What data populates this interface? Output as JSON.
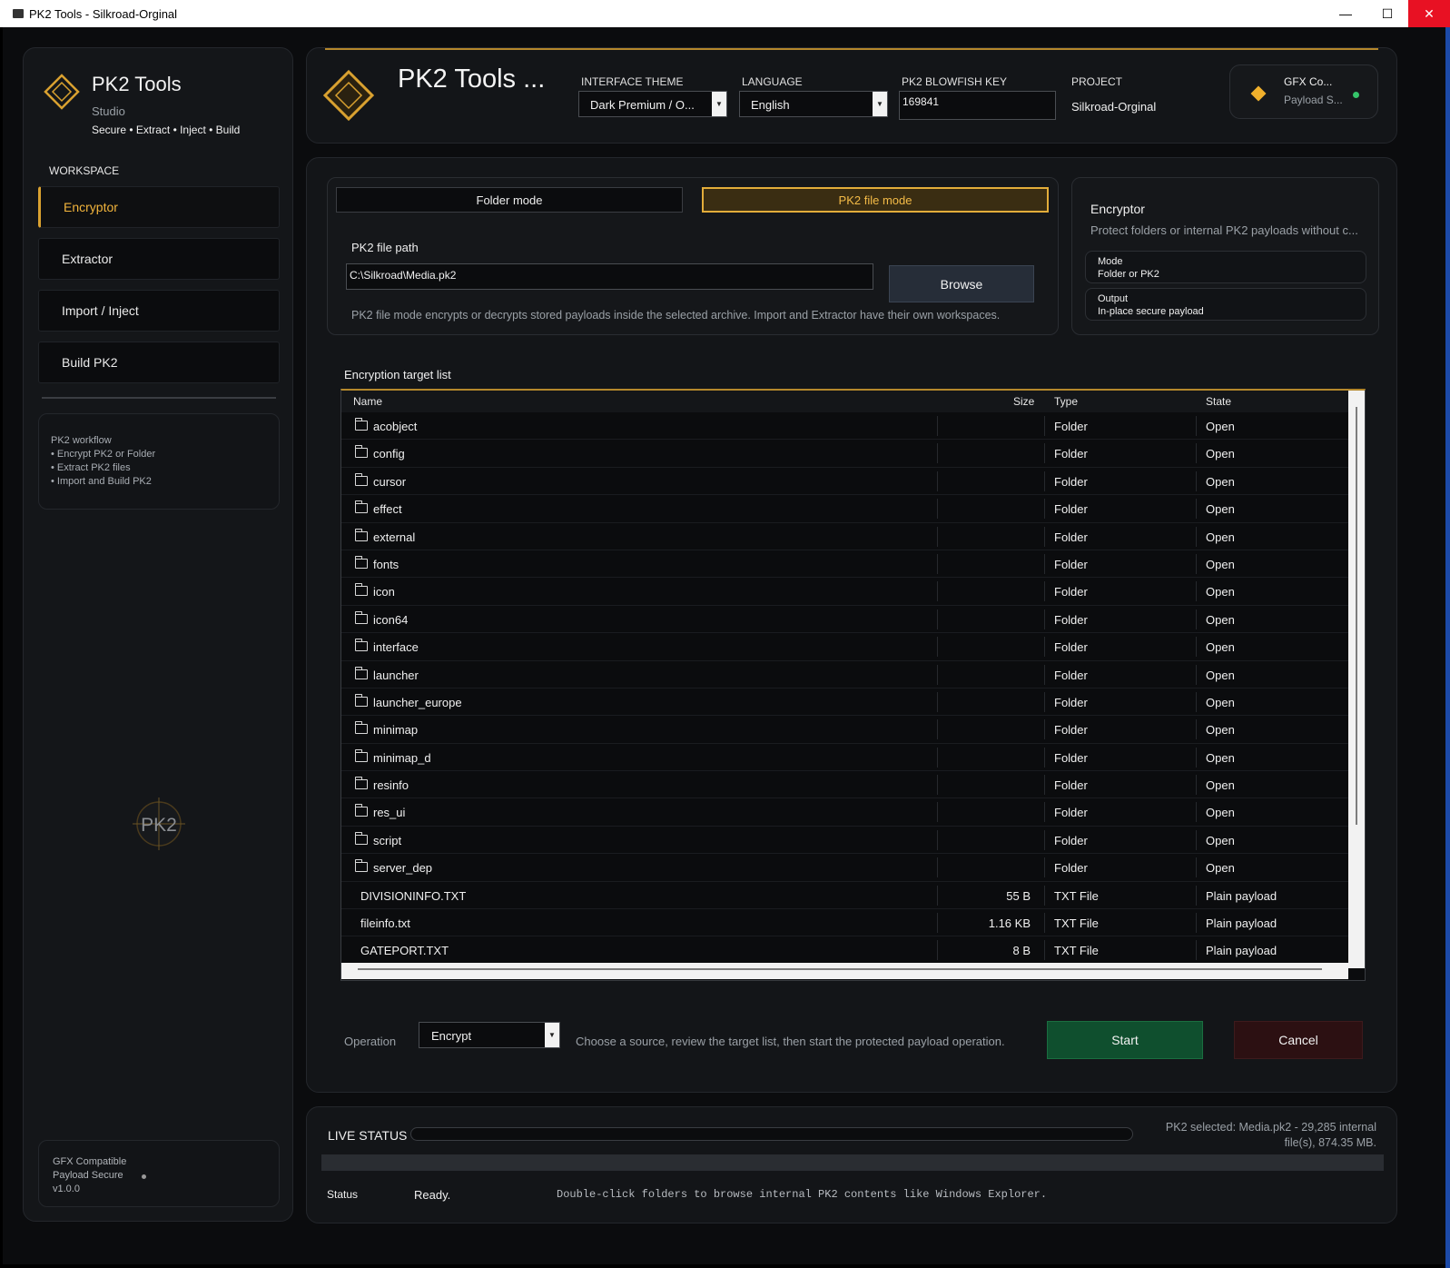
{
  "window": {
    "title": "PK2 Tools - Silkroad-Orginal",
    "controls": {
      "minimize": "—",
      "maximize": "☐",
      "close": "✕"
    }
  },
  "sidebar": {
    "brand_title": "PK2 Tools",
    "brand_subtitle": "Studio",
    "brand_tagline": "Secure • Extract • Inject • Build",
    "workspace_label": "WORKSPACE",
    "nav": [
      "Encryptor",
      "Extractor",
      "Import / Inject",
      "Build PK2"
    ],
    "active_nav": "Encryptor",
    "workflow": {
      "title": "PK2 workflow",
      "items": [
        "• Encrypt PK2 or Folder",
        "• Extract PK2 files",
        "• Import and Build PK2"
      ]
    },
    "emblem_text": "PK2",
    "footer": {
      "line1": "GFX Compatible",
      "line2": "Payload Secure",
      "line3": "v1.0.0"
    }
  },
  "header": {
    "title": "PK2 Tools ...",
    "theme_label": "INTERFACE THEME",
    "theme_value": "Dark Premium / O...",
    "language_label": "LANGUAGE",
    "language_value": "English",
    "key_label": "PK2 BLOWFISH KEY",
    "key_value": "169841",
    "project_label": "PROJECT",
    "project_value": "Silkroad-Orginal",
    "gfx_title": "GFX Co...",
    "gfx_sub": "Payload S..."
  },
  "source": {
    "folder_mode": "Folder mode",
    "pk2_mode": "PK2 file mode",
    "active_mode": "PK2 file mode",
    "path_label": "PK2 file path",
    "path_value": "C:\\Silkroad\\Media.pk2",
    "browse_label": "Browse",
    "hint": "PK2 file mode encrypts or decrypts stored payloads inside the selected archive. Import and Extractor have their own workspaces."
  },
  "info": {
    "title": "Encryptor",
    "description": "Protect folders or internal PK2 payloads without c...",
    "mode_label": "Mode",
    "mode_value": "Folder or PK2",
    "output_label": "Output",
    "output_value": "In-place secure payload"
  },
  "target_list": {
    "label": "Encryption target list",
    "columns": {
      "name": "Name",
      "size": "Size",
      "type": "Type",
      "state": "State"
    },
    "rows": [
      {
        "name": "acobject",
        "size": "",
        "type": "Folder",
        "state": "Open",
        "is_folder": true
      },
      {
        "name": "config",
        "size": "",
        "type": "Folder",
        "state": "Open",
        "is_folder": true
      },
      {
        "name": "cursor",
        "size": "",
        "type": "Folder",
        "state": "Open",
        "is_folder": true
      },
      {
        "name": "effect",
        "size": "",
        "type": "Folder",
        "state": "Open",
        "is_folder": true
      },
      {
        "name": "external",
        "size": "",
        "type": "Folder",
        "state": "Open",
        "is_folder": true
      },
      {
        "name": "fonts",
        "size": "",
        "type": "Folder",
        "state": "Open",
        "is_folder": true
      },
      {
        "name": "icon",
        "size": "",
        "type": "Folder",
        "state": "Open",
        "is_folder": true
      },
      {
        "name": "icon64",
        "size": "",
        "type": "Folder",
        "state": "Open",
        "is_folder": true
      },
      {
        "name": "interface",
        "size": "",
        "type": "Folder",
        "state": "Open",
        "is_folder": true
      },
      {
        "name": "launcher",
        "size": "",
        "type": "Folder",
        "state": "Open",
        "is_folder": true
      },
      {
        "name": "launcher_europe",
        "size": "",
        "type": "Folder",
        "state": "Open",
        "is_folder": true
      },
      {
        "name": "minimap",
        "size": "",
        "type": "Folder",
        "state": "Open",
        "is_folder": true
      },
      {
        "name": "minimap_d",
        "size": "",
        "type": "Folder",
        "state": "Open",
        "is_folder": true
      },
      {
        "name": "resinfo",
        "size": "",
        "type": "Folder",
        "state": "Open",
        "is_folder": true
      },
      {
        "name": "res_ui",
        "size": "",
        "type": "Folder",
        "state": "Open",
        "is_folder": true
      },
      {
        "name": "script",
        "size": "",
        "type": "Folder",
        "state": "Open",
        "is_folder": true
      },
      {
        "name": "server_dep",
        "size": "",
        "type": "Folder",
        "state": "Open",
        "is_folder": true
      },
      {
        "name": "DIVISIONINFO.TXT",
        "size": "55 B",
        "type": "TXT File",
        "state": "Plain payload",
        "is_folder": false
      },
      {
        "name": "fileinfo.txt",
        "size": "1.16 KB",
        "type": "TXT File",
        "state": "Plain payload",
        "is_folder": false
      },
      {
        "name": "GATEPORT.TXT",
        "size": "8 B",
        "type": "TXT File",
        "state": "Plain payload",
        "is_folder": false
      }
    ]
  },
  "operation": {
    "label": "Operation",
    "value": "Encrypt",
    "hint": "Choose a source, review the target list, then start the protected payload operation.",
    "start_label": "Start",
    "cancel_label": "Cancel"
  },
  "status": {
    "live_label": "LIVE STATUS",
    "progress": 0,
    "selection_info_line1": "PK2 selected: Media.pk2 - 29,285 internal",
    "selection_info_line2": "file(s), 874.35 MB.",
    "status_label": "Status",
    "status_value": "Ready.",
    "message": "Double-click folders to browse internal PK2 contents like Windows Explorer."
  },
  "colors": {
    "accent": "#e3ad3a",
    "start": "#0f4f2e",
    "cancel": "#2c1012",
    "online": "#35c46a"
  }
}
